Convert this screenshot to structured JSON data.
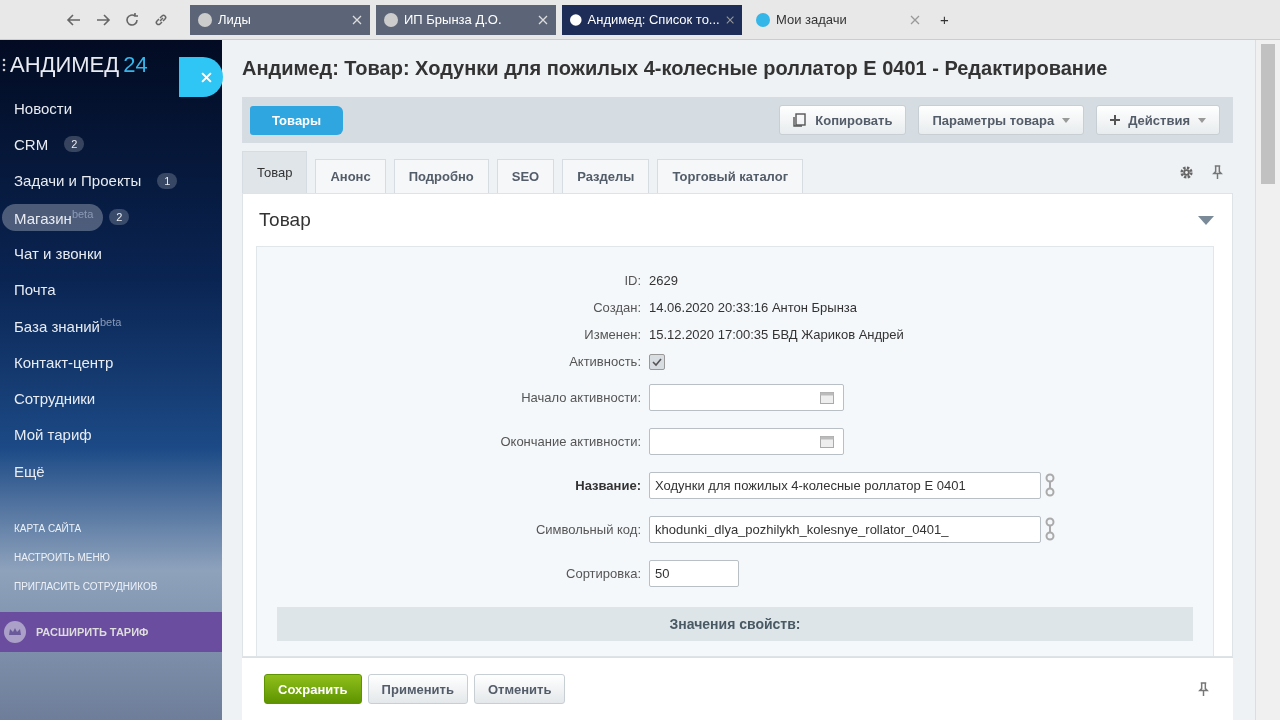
{
  "browser": {
    "tabs": [
      {
        "title": "Лиды",
        "selected": false
      },
      {
        "title": "ИП Брынза Д.О.",
        "selected": false
      },
      {
        "title": "Андимед: Список то...",
        "selected": true
      },
      {
        "title": "Мои задачи",
        "selected": false
      }
    ],
    "new_tab": "+"
  },
  "sidebar": {
    "logo": {
      "name": "АНДИМЕД",
      "number": "24"
    },
    "items": [
      {
        "label": "Новости",
        "selected": false
      },
      {
        "label": "CRM",
        "badge": "2",
        "selected": false
      },
      {
        "label": "Задачи и Проекты",
        "badge": "1",
        "selected": false
      },
      {
        "label": "Магазин",
        "sup": "beta",
        "badge": "2",
        "selected": true
      },
      {
        "label": "Чат и звонки",
        "selected": false
      },
      {
        "label": "Почта",
        "selected": false
      },
      {
        "label": "База знаний",
        "sup": "beta",
        "selected": false
      },
      {
        "label": "Контакт-центр",
        "selected": false
      },
      {
        "label": "Сотрудники",
        "selected": false
      },
      {
        "label": "Мой тариф",
        "selected": false
      },
      {
        "label": "Ещё",
        "selected": false
      }
    ],
    "links": [
      "КАРТА САЙТА",
      "НАСТРОИТЬ МЕНЮ",
      "ПРИГЛАСИТЬ СОТРУДНИКОВ"
    ],
    "upgrade": "РАСШИРИТЬ ТАРИФ"
  },
  "page": {
    "title": "Андимед: Товар: Ходунки для пожилых 4-колесные роллатор E 0401 - Редактирование",
    "back": "Товары",
    "actions": [
      {
        "label": "Копировать",
        "kind": "copy"
      },
      {
        "label": "Параметры товара",
        "kind": "menu"
      },
      {
        "label": "Действия",
        "kind": "add"
      }
    ],
    "tabs": [
      {
        "label": "Товар",
        "selected": true
      },
      {
        "label": "Анонс",
        "selected": false
      },
      {
        "label": "Подробно",
        "selected": false
      },
      {
        "label": "SEO",
        "selected": false
      },
      {
        "label": "Разделы",
        "selected": false
      },
      {
        "label": "Торговый каталог",
        "selected": false
      }
    ],
    "section": "Товар",
    "fields": [
      {
        "kind": "text",
        "label": "ID:",
        "value": "2629"
      },
      {
        "kind": "text",
        "label": "Создан:",
        "value": "14.06.2020 20:33:16 Антон Брынза"
      },
      {
        "kind": "text",
        "label": "Изменен:",
        "value": "15.12.2020 17:00:35 БВД Жариков Андрей"
      },
      {
        "kind": "checkbox",
        "label": "Активность:",
        "checked": true
      },
      {
        "kind": "date",
        "label": "Начало активности:"
      },
      {
        "kind": "date",
        "label": "Окончание активности:"
      },
      {
        "kind": "input",
        "label": "Название:",
        "value": "Ходунки для пожилых 4-колесные роллатор E 0401",
        "required": true
      },
      {
        "kind": "input",
        "label": "Символьный код:",
        "value": "khodunki_dlya_pozhilykh_kolesnye_rollator_0401_",
        "required": false
      },
      {
        "kind": "short",
        "label": "Сортировка:",
        "value": "50"
      }
    ],
    "properties": "Значения свойств:",
    "footer": [
      {
        "label": "Сохранить",
        "kind": "primary"
      },
      {
        "label": "Применить",
        "kind": "plain"
      },
      {
        "label": "Отменить",
        "kind": "plain"
      }
    ]
  }
}
